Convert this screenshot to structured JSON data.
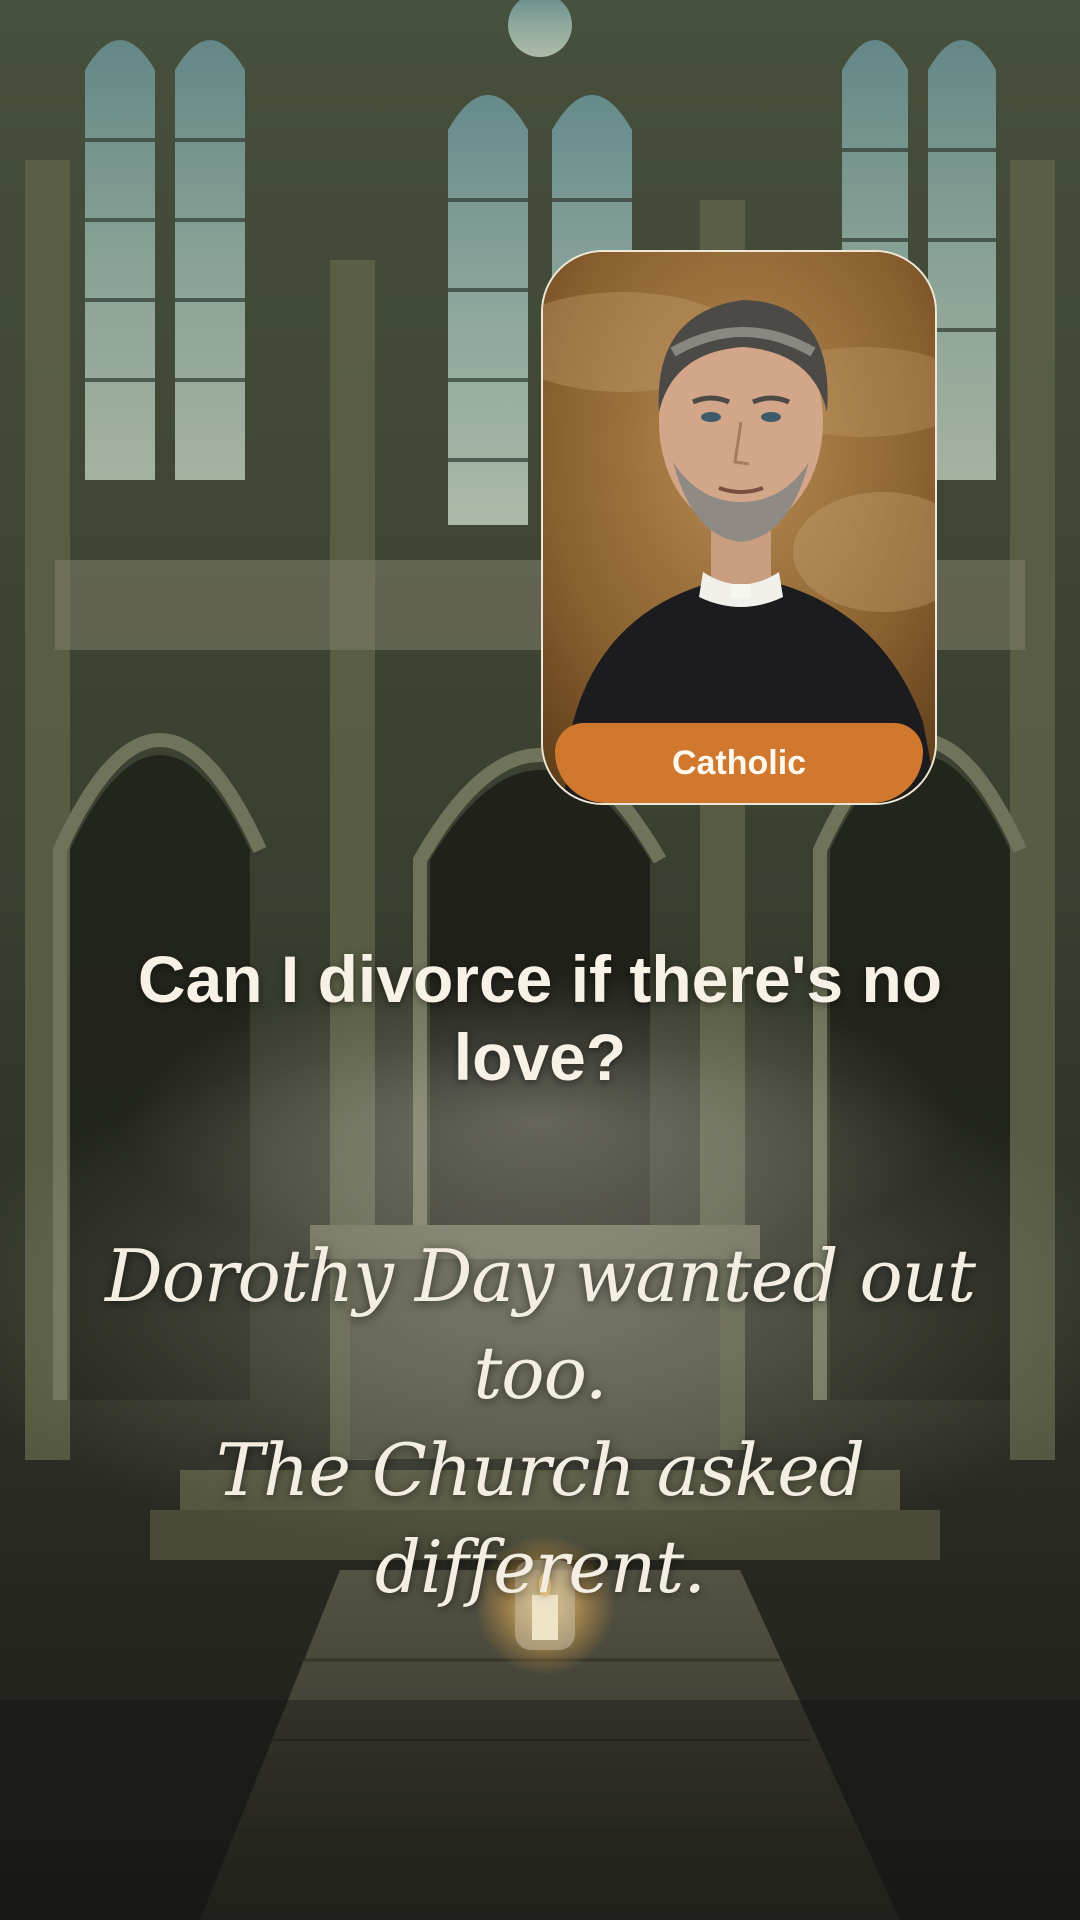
{
  "portrait": {
    "badge_label": "Catholic",
    "accent_color": "#cf782e"
  },
  "headline": {
    "text": "Can I divorce if there's no love?"
  },
  "subtext": {
    "line1": "Dorothy Day wanted out too.",
    "line2": "The Church asked different."
  }
}
